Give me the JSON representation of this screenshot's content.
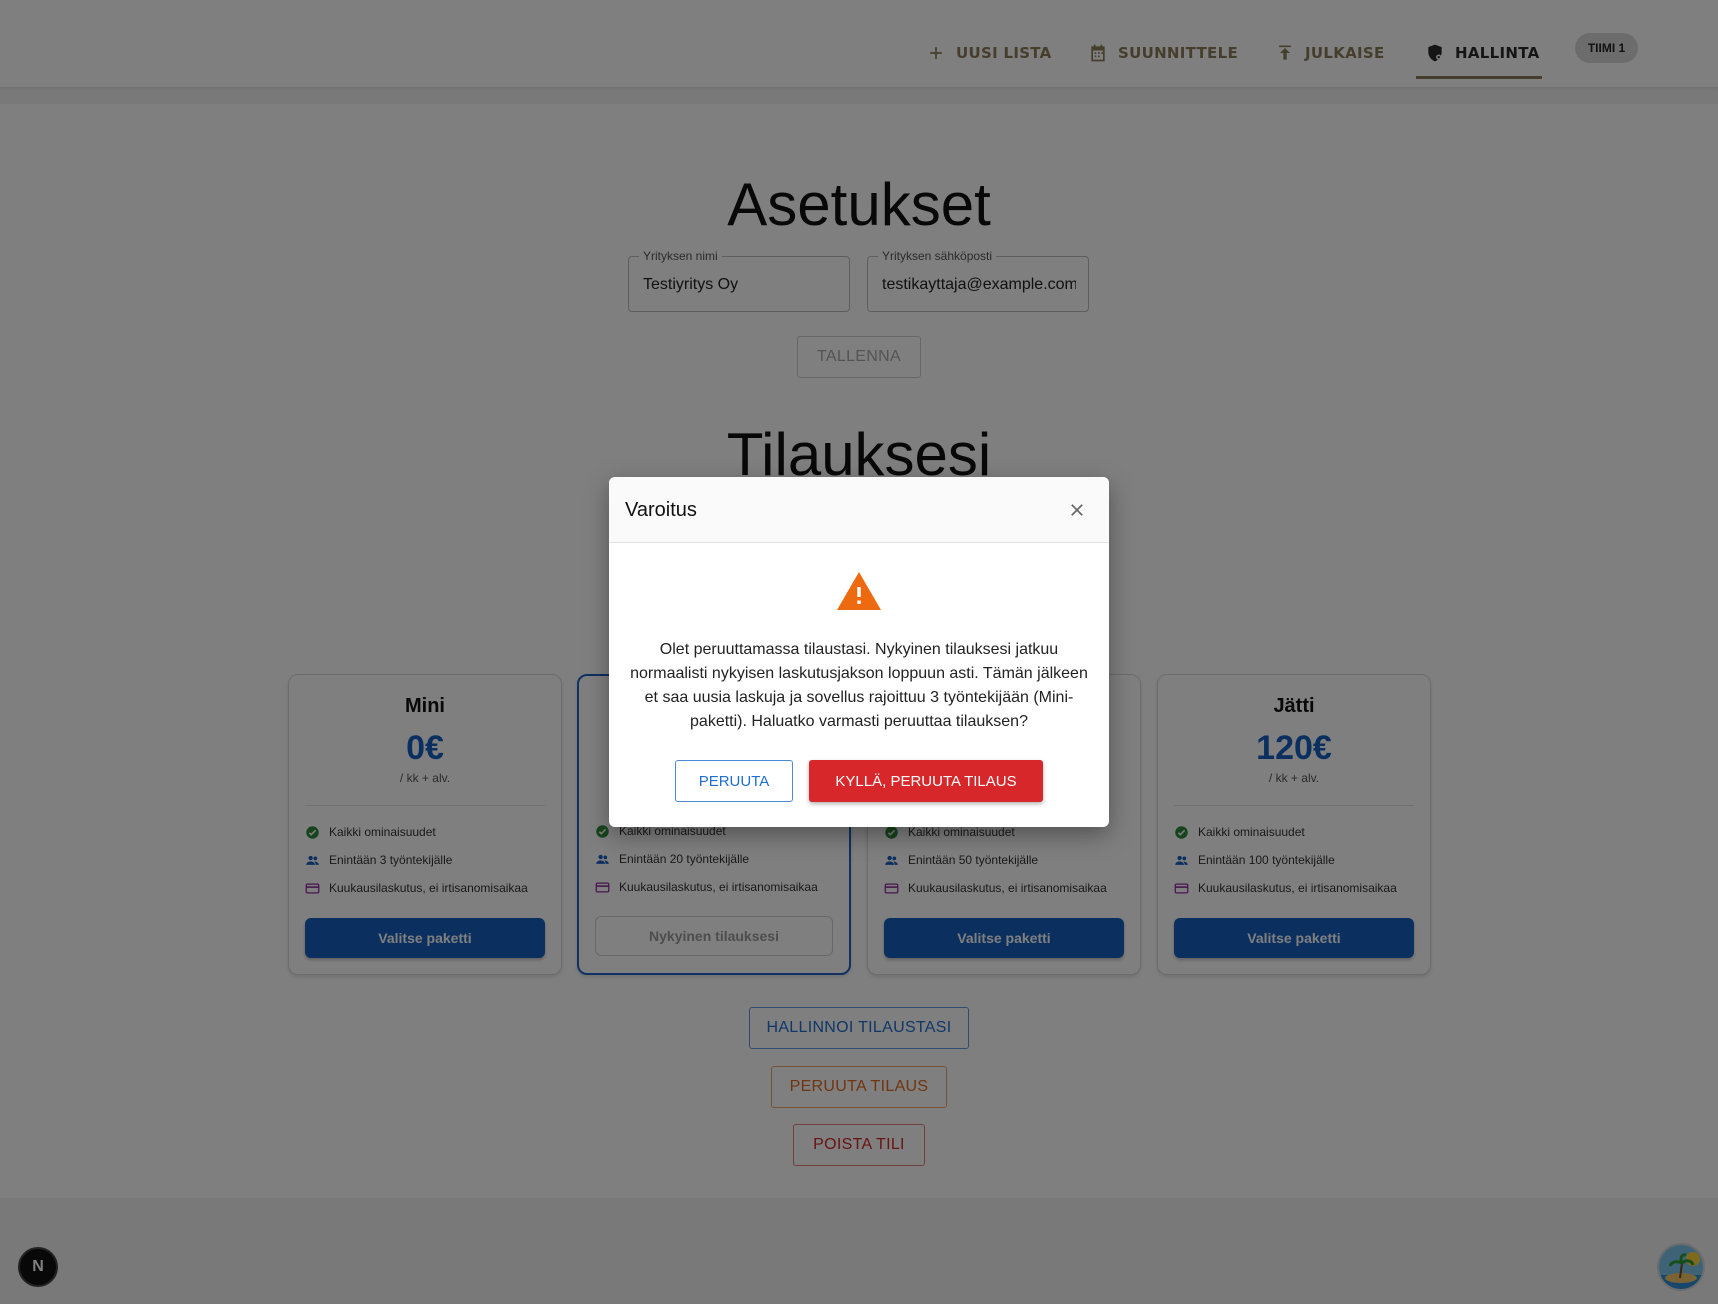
{
  "nav": {
    "items": [
      {
        "label": "UUSI LISTA",
        "icon": "plus-icon"
      },
      {
        "label": "SUUNNITTELE",
        "icon": "calendar-icon"
      },
      {
        "label": "JULKAISE",
        "icon": "upload-icon"
      },
      {
        "label": "HALLINTA",
        "icon": "shield-settings-icon",
        "active": true
      }
    ],
    "team": "TIIMI 1",
    "accent_color": "#8a7c5a"
  },
  "settings": {
    "title": "Asetukset",
    "company_name_label": "Yrityksen nimi",
    "company_name_value": "Testiyritys Oy",
    "company_email_label": "Yrityksen sähköposti",
    "company_email_value": "testikayttaja@example.com",
    "save_label": "TALLENNA"
  },
  "subscription": {
    "title": "Tilauksesi",
    "plans": [
      {
        "name": "Mini",
        "price": "0€",
        "per": "/ kk + alv.",
        "features": [
          "Kaikki ominaisuudet",
          "Enintään 3 työntekijälle",
          "Kuukausilaskutus, ei irtisanomisaikaa"
        ],
        "button": "Valitse paketti"
      },
      {
        "name": "",
        "price": "",
        "per": "",
        "features": [
          "Kaikki ominaisuudet",
          "Enintään 20 työntekijälle",
          "Kuukausilaskutus, ei irtisanomisaikaa"
        ],
        "button": "Nykyinen tilauksesi",
        "current": true
      },
      {
        "name": "",
        "price": "",
        "per": "",
        "features": [
          "Kaikki ominaisuudet",
          "Enintään 50 työntekijälle",
          "Kuukausilaskutus, ei irtisanomisaikaa"
        ],
        "button": "Valitse paketti"
      },
      {
        "name": "Jätti",
        "price": "120€",
        "per": "/ kk + alv.",
        "features": [
          "Kaikki ominaisuudet",
          "Enintään 100 työntekijälle",
          "Kuukausilaskutus, ei irtisanomisaikaa"
        ],
        "button": "Valitse paketti"
      }
    ],
    "manage_label": "HALLINNOI TILAUSTASI",
    "cancel_label": "PERUUTA TILAUS",
    "delete_label": "POISTA TILI",
    "brand_color": "#1660c0"
  },
  "dialog": {
    "title": "Varoitus",
    "message": "Olet peruuttamassa tilaustasi. Nykyinen tilauksesi jatkuu normaalisti nykyisen laskutusjakson loppuun asti. Tämän jälkeen et saa uusia laskuja ja sovellus rajoittuu 3 työntekijään (Mini-paketti). Haluatko varmasti peruuttaa tilauksen?",
    "cancel_label": "PERUUTA",
    "confirm_label": "KYLLÄ, PERUUTA TILAUS",
    "warning_color": "#ee6a10",
    "danger_color": "#d8272a"
  },
  "dev_badge": "N"
}
